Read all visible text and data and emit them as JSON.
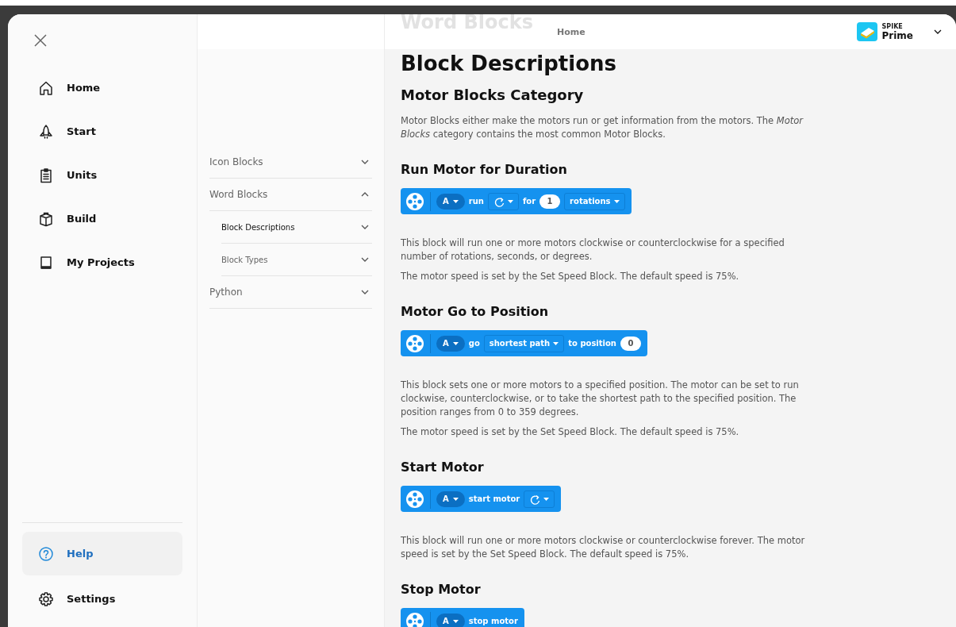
{
  "sidebar": {
    "items": [
      {
        "label": "Home",
        "selected": false
      },
      {
        "label": "Start",
        "selected": false
      },
      {
        "label": "Units",
        "selected": false
      },
      {
        "label": "Build",
        "selected": false
      },
      {
        "label": "My Projects",
        "selected": false
      }
    ],
    "bottom_items": [
      {
        "label": "Help",
        "selected": true
      },
      {
        "label": "Settings",
        "selected": false
      }
    ]
  },
  "nav": {
    "items": [
      {
        "label": "Icon Blocks",
        "expanded": false
      },
      {
        "label": "Word Blocks",
        "expanded": true,
        "children": [
          {
            "label": "Block Descriptions",
            "selected": true,
            "expanded": false
          },
          {
            "label": "Block Types",
            "selected": false,
            "expanded": false
          }
        ]
      },
      {
        "label": "Python",
        "expanded": false
      }
    ]
  },
  "header": {
    "section_title": "Word Blocks",
    "breadcrumb": "Home",
    "product": {
      "line1": "SPIKE",
      "line2": "Prime"
    }
  },
  "content": {
    "title": "Block Descriptions",
    "category": {
      "heading": "Motor Blocks Category",
      "intro": "Motor Blocks either make the motors run or get information from the motors. The *Motor Blocks* category contains the most common Motor Blocks."
    },
    "entries": [
      {
        "heading": "Run Motor for Duration",
        "block": [
          {
            "kind": "port",
            "text": "A"
          },
          {
            "kind": "text",
            "text": "run"
          },
          {
            "kind": "direction"
          },
          {
            "kind": "text",
            "text": "for"
          },
          {
            "kind": "number",
            "text": "1"
          },
          {
            "kind": "select",
            "text": "rotations"
          }
        ],
        "paragraphs": [
          "This block will run one or more motors clockwise or counterclockwise for a specified number of rotations, seconds, or degrees.",
          "The motor speed is set by the Set Speed Block. The default speed is 75%."
        ]
      },
      {
        "heading": "Motor Go to Position",
        "block": [
          {
            "kind": "port",
            "text": "A"
          },
          {
            "kind": "text",
            "text": "go"
          },
          {
            "kind": "select",
            "text": "shortest path"
          },
          {
            "kind": "text",
            "text": "to position"
          },
          {
            "kind": "number",
            "text": "0"
          }
        ],
        "paragraphs": [
          "This block sets one or more motors to a specified position. The motor can be set to run clockwise, counterclockwise, or to take the shortest path to the specified position. The position ranges from 0 to 359 degrees.",
          "The motor speed is set by the Set Speed Block. The default speed is 75%."
        ]
      },
      {
        "heading": "Start Motor",
        "block": [
          {
            "kind": "port",
            "text": "A"
          },
          {
            "kind": "text",
            "text": "start motor"
          },
          {
            "kind": "direction"
          }
        ],
        "paragraphs": [
          "This block will run one or more motors clockwise or counterclockwise forever. The motor speed is set by the Set Speed Block. The default speed is 75%."
        ]
      },
      {
        "heading": "Stop Motor",
        "block": [
          {
            "kind": "port",
            "text": "A"
          },
          {
            "kind": "text",
            "text": "stop motor"
          }
        ]
      }
    ]
  }
}
